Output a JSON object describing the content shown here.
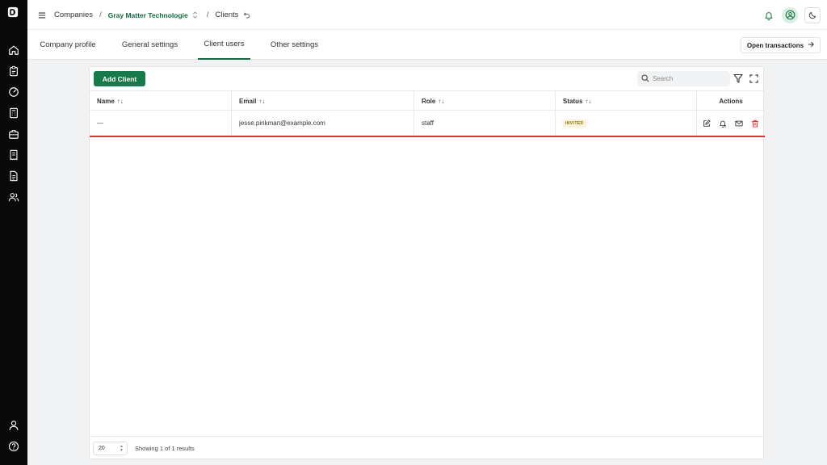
{
  "sidebar": {
    "logo": "logo-icon",
    "items": [
      {
        "name": "home-icon"
      },
      {
        "name": "clipboard-icon"
      },
      {
        "name": "gauge-icon"
      },
      {
        "name": "calculator-icon"
      },
      {
        "name": "briefcase-icon"
      },
      {
        "name": "receipt-icon"
      },
      {
        "name": "document-icon"
      },
      {
        "name": "users-icon"
      }
    ],
    "bottom": [
      {
        "name": "user-icon"
      },
      {
        "name": "help-icon"
      }
    ]
  },
  "breadcrumb": {
    "companies": "Companies",
    "sep1": "/",
    "company": "Gray Matter Technologie",
    "sep2": "/",
    "current": "Clients"
  },
  "tabs": [
    {
      "label": "Company profile"
    },
    {
      "label": "General settings"
    },
    {
      "label": "Client users",
      "active": true
    },
    {
      "label": "Other settings"
    }
  ],
  "open_transactions": "Open transactions",
  "toolbar": {
    "add_client": "Add Client",
    "search_placeholder": "Search"
  },
  "table": {
    "columns": [
      {
        "label": "Name",
        "sort": "↑↓"
      },
      {
        "label": "Email",
        "sort": "↑↓"
      },
      {
        "label": "Role",
        "sort": "↑↓"
      },
      {
        "label": "Status",
        "sort": "↑↓"
      },
      {
        "label": "Actions"
      }
    ],
    "rows": [
      {
        "name": "—",
        "email": "jesse.pinkman@example.com",
        "role": "staff",
        "status": "INVITED"
      }
    ]
  },
  "footer": {
    "page_size": "20",
    "showing": "Showing 1 of 1 results"
  },
  "colors": {
    "accent": "#187a4a",
    "sidebar": "#0a0a0a",
    "danger": "#d93434"
  }
}
